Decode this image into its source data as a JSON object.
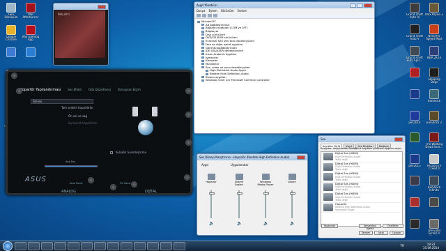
{
  "desktop_left": [
    {
      "label": "Geri Dönüşüm Kutusu",
      "color": "#9fb6c9"
    },
    {
      "label": "MSI Afterburner",
      "color": "#a3121c"
    },
    {
      "label": "Google Chrome",
      "color": "#e8b12a"
    },
    {
      "label": "MSI Gaming App",
      "color": "#b80f1c"
    },
    {
      "label": "",
      "color": "#3b7ad2"
    },
    {
      "label": "",
      "color": "#2a7fd4"
    },
    {
      "label": "",
      "color": "#c8d8e8"
    },
    {
      "label": "",
      "color": "#6aa84f"
    },
    {
      "label": "",
      "color": "#d04030"
    },
    {
      "label": "",
      "color": "#8a9aaa"
    },
    {
      "label": "Bilgisayar",
      "color": "#b9c7d6"
    }
  ],
  "desktop_right": [
    {
      "label": "Grand Theft Auto IV",
      "color": "#3c3c3c"
    },
    {
      "label": "Max Payne 3",
      "color": "#6a5a3a"
    },
    {
      "label": "Grand Theft Auto V",
      "color": "#202020"
    },
    {
      "label": "Need for Speed Most Wanted",
      "color": "#c8401a"
    },
    {
      "label": "Grand Theft Auto Epis...",
      "color": "#404a55"
    },
    {
      "label": "NBA 2K14",
      "color": "#2d3f7a"
    },
    {
      "label": "",
      "color": "#b02020"
    },
    {
      "label": "Sleeping Dogs",
      "color": "#1e1e1e"
    },
    {
      "label": "",
      "color": "#1a3a8a"
    },
    {
      "label": "BioShock",
      "color": "#3a6a7a"
    },
    {
      "label": "pes2014",
      "color": "#1e3a9a"
    },
    {
      "label": "BioShock 2",
      "color": "#5a4a2a"
    },
    {
      "label": "",
      "color": "#2a5a2a"
    },
    {
      "label": "The Walking Dead Seas...",
      "color": "#7a1a1a"
    },
    {
      "label": "pes2013",
      "color": "#1a3a8a"
    },
    {
      "label": "Assassin's Creed II",
      "color": "#c9c9c9"
    },
    {
      "label": "",
      "color": "#3a3a4a"
    },
    {
      "label": "BioShock Infinite",
      "color": "#3a4a5a"
    },
    {
      "label": "",
      "color": "#aa3030"
    },
    {
      "label": "",
      "color": "#4a4a4a"
    },
    {
      "label": "",
      "color": "#2a2a2a"
    },
    {
      "label": "The Elder Scrolls V Skyrim",
      "color": "#6a6a6a"
    }
  ],
  "player": {
    "title": "",
    "album_text": "Bob Acri"
  },
  "asus": {
    "tabs": [
      "Hoparlör Yapılandırması",
      "Ses Efekti",
      "Oda Düzeltmesi",
      "Varsayılan Biçim"
    ],
    "dropdown": "Stereo",
    "options": [
      "Tam aralıklı hoparlörler",
      "Ön sol ve sağ",
      "Surround hoparlörler"
    ],
    "virtual_label": "Kulaklık Sanallaştırma",
    "main_volume": "Ana Ses",
    "footer_left": "ANALOG",
    "footer_right": "DİJİTAL",
    "arka_panel": "Arka Panel",
    "on_panel": "Ön Panel",
    "logo": "ASUS"
  },
  "devmgr": {
    "title": "Aygıt Yöneticisi",
    "menu": [
      "Dosya",
      "Eylem",
      "Görünüm",
      "Yardım"
    ],
    "tree": [
      "Michael-PC",
      "Ağ bağdaştırıcıları",
      "Bağlantı noktaları (COM ve LPT)",
      "Bilgisayar",
      "Disk sürücüleri",
      "DVD/CD-ROM sürücüleri",
      "Evrensel Seri Veri Yolu denetleyicileri",
      "Fare ve diğer işaret aygıtları",
      "Görüntü bağdaştırıcıları",
      "IDE ATA/ATAPI denetleyicileri",
      "İnsan Arabirim Aygıtları",
      "İşlemciler",
      "Klavyeler",
      "Monitörler",
      "Ses, video ve oyun denetleyicileri",
      "High Definition Audio Aygıtı",
      "Realtek High Definition Audio",
      "Sistem aygıtları",
      "Windows Sınıfı için Microsoft Common Controller"
    ]
  },
  "mixer": {
    "title": "Ses Düzeyi Karıştırıcısı - Hoparlör (Realtek High Definition Audio)",
    "device_label": "Aygıt",
    "apps_label": "Uygulamalar",
    "columns": [
      {
        "name": "Hoparlör",
        "level": 0.95
      },
      {
        "name": "Sistem Sesleri",
        "level": 0.95
      },
      {
        "name": "Windows Media Player",
        "level": 0.95
      },
      {
        "name": "Steam",
        "level": 0.95
      }
    ]
  },
  "sound": {
    "title": "Ses",
    "tabs": [
      "Kayıttan Yürüt",
      "Kayıt",
      "Ses Efektleri",
      "Değişim"
    ],
    "desc": "Aşağıdan değiştirmek istediğiniz kayıttan yürütme aygıtını seçin:",
    "devices": [
      {
        "name": "Dijital Ses (HDMI)",
        "sub": "High Definition Audio",
        "state": "Takılı değil"
      },
      {
        "name": "Dijital Ses (HDMI)",
        "sub": "High Definition Audio",
        "state": "Takılı değil"
      },
      {
        "name": "Dijital Ses (HDMI)",
        "sub": "High Definition Audio",
        "state": "Takılı değil"
      },
      {
        "name": "Dijital Ses (HDMI)",
        "sub": "High Definition Audio",
        "state": "Takılı değil"
      },
      {
        "name": "Dijital Ses (HDMI)",
        "sub": "High Definition Audio",
        "state": "Takılı değil"
      },
      {
        "name": "Hoparlör",
        "sub": "Realtek High Definition Audio",
        "state": "Varsayılan Aygıt"
      }
    ],
    "btn_configure": "Yapılandır",
    "btn_default": "Varsayılanı Ayarla",
    "btn_properties": "Özellikler",
    "btn_ok": "Tamam",
    "btn_cancel": "İptal",
    "btn_apply": "Uygula"
  },
  "taskbar": {
    "time": "19:33",
    "date": "25.09.2014",
    "lang": "TR"
  }
}
